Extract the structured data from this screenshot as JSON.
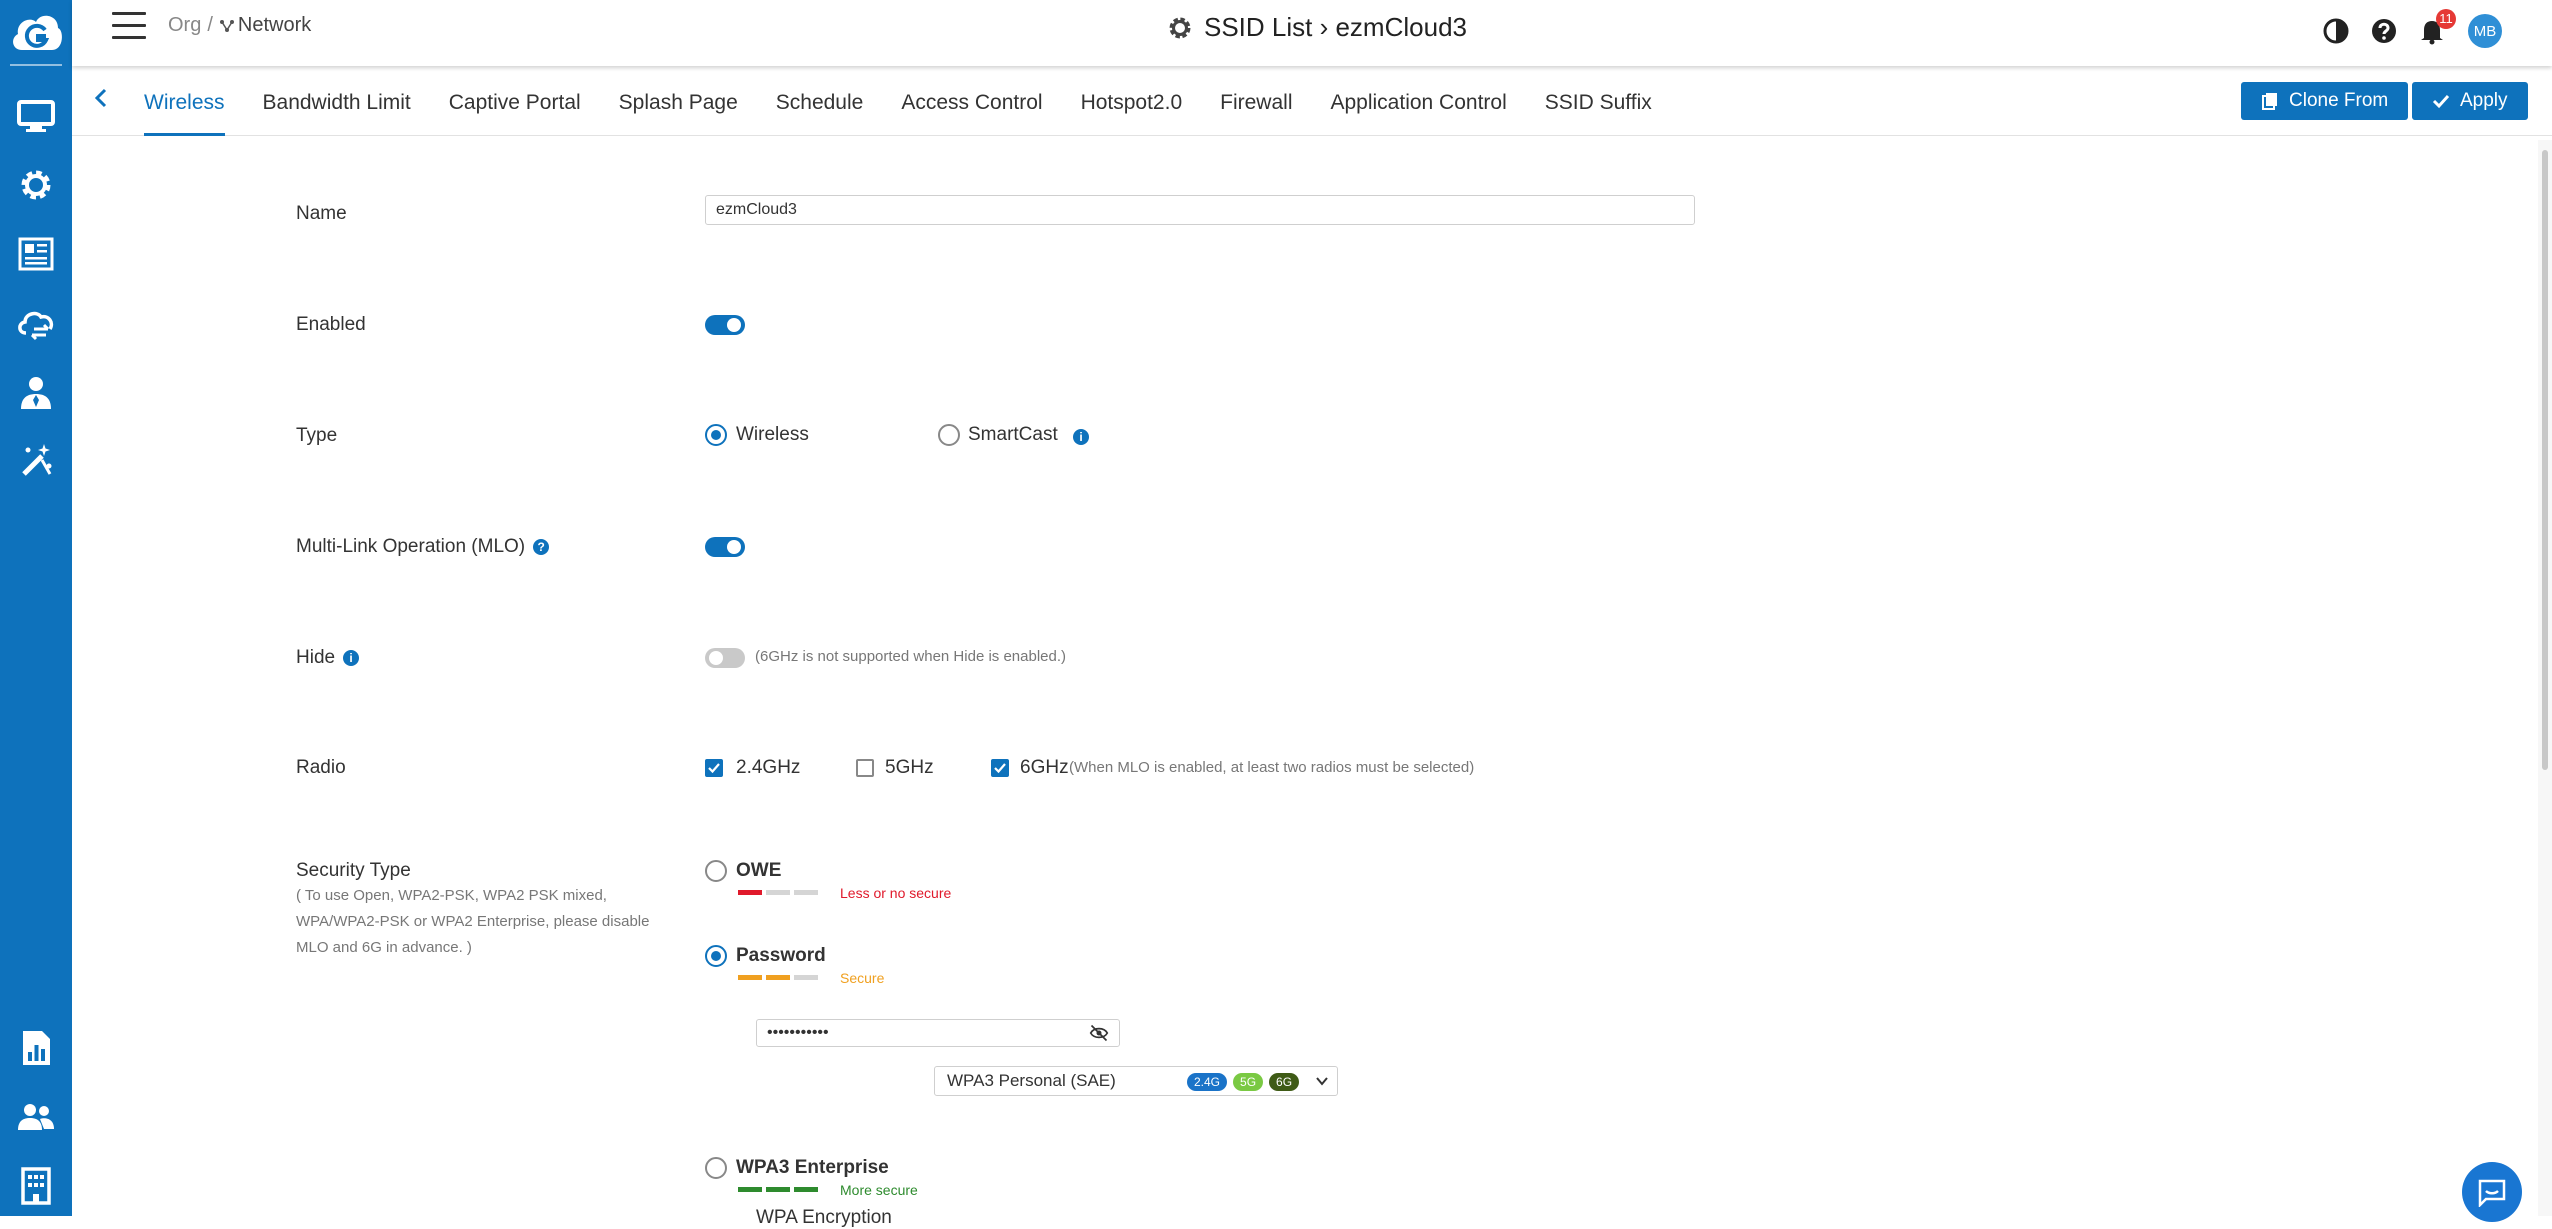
{
  "topbar": {
    "breadcrumb_org": "Org",
    "breadcrumb_sep": "/",
    "breadcrumb_network": "Network",
    "title": "SSID List › ezmCloud3",
    "notification_count": "11",
    "avatar_initials": "MB"
  },
  "tabs": [
    "Wireless",
    "Bandwidth Limit",
    "Captive Portal",
    "Splash Page",
    "Schedule",
    "Access Control",
    "Hotspot2.0",
    "Firewall",
    "Application Control",
    "SSID Suffix"
  ],
  "active_tab": "Wireless",
  "actions": {
    "clone_label": "Clone From",
    "apply_label": "Apply"
  },
  "form": {
    "name": {
      "label": "Name",
      "value": "ezmCloud3"
    },
    "enabled": {
      "label": "Enabled",
      "on": true
    },
    "type": {
      "label": "Type",
      "options": [
        "Wireless",
        "SmartCast"
      ],
      "selected": "Wireless"
    },
    "mlo": {
      "label": "Multi-Link Operation (MLO)",
      "on": true
    },
    "hide": {
      "label": "Hide",
      "on": false,
      "hint": "(6GHz is not supported when Hide is enabled.)"
    },
    "radio": {
      "label": "Radio",
      "options": [
        {
          "label": "2.4GHz",
          "checked": true
        },
        {
          "label": "5GHz",
          "checked": false
        },
        {
          "label": "6GHz",
          "checked": true
        }
      ],
      "hint": "(When MLO is enabled, at least two radios must be selected)"
    },
    "security": {
      "label": "Security Type",
      "note": "( To use Open, WPA2-PSK, WPA2 PSK mixed, WPA/WPA2-PSK or WPA2 Enterprise, please disable MLO and 6G in advance. )",
      "options": [
        {
          "label": "OWE",
          "strength": "Less or no secure",
          "level": 1,
          "selected": false
        },
        {
          "label": "Password",
          "strength": "Secure",
          "level": 2,
          "selected": true
        },
        {
          "label": "WPA3 Enterprise",
          "strength": "More secure",
          "level": 3,
          "selected": false
        }
      ],
      "password_value": "•••••••••••",
      "wpa_label": "WPA Encryption",
      "wpa_value": "WPA3 Personal (SAE)",
      "wpa_bands": [
        "2.4G",
        "5G",
        "6G"
      ]
    }
  },
  "colors": {
    "brand": "#0e72bc",
    "weak": "#e0192b",
    "medium": "#f0a020",
    "strong": "#2e8b2e",
    "band_24": "#1a73c8",
    "band_5": "#7ac943",
    "band_6": "#3f5b16"
  }
}
